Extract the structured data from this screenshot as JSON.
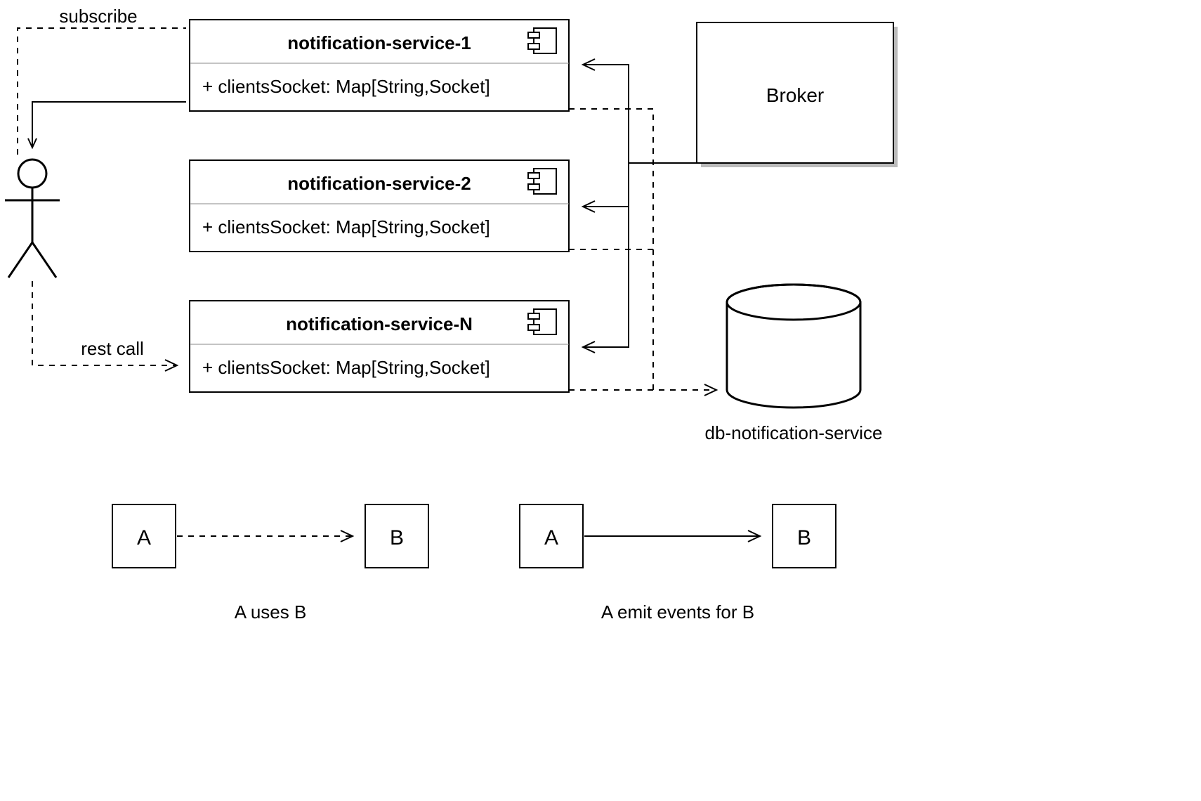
{
  "nodes": {
    "service1": {
      "title": "notification-service-1",
      "attr": "+ clientsSocket: Map[String,Socket]"
    },
    "service2": {
      "title": "notification-service-2",
      "attr": "+ clientsSocket: Map[String,Socket]"
    },
    "serviceN": {
      "title": "notification-service-N",
      "attr": "+ clientsSocket: Map[String,Socket]"
    },
    "broker": {
      "title": "Broker"
    },
    "db": {
      "title": "db-notification-service"
    }
  },
  "edges": {
    "subscribe": "subscribe",
    "restcall": "rest call"
  },
  "legend": {
    "a": "A",
    "b": "B",
    "uses": "A uses B",
    "emits": "A emit events for B"
  }
}
